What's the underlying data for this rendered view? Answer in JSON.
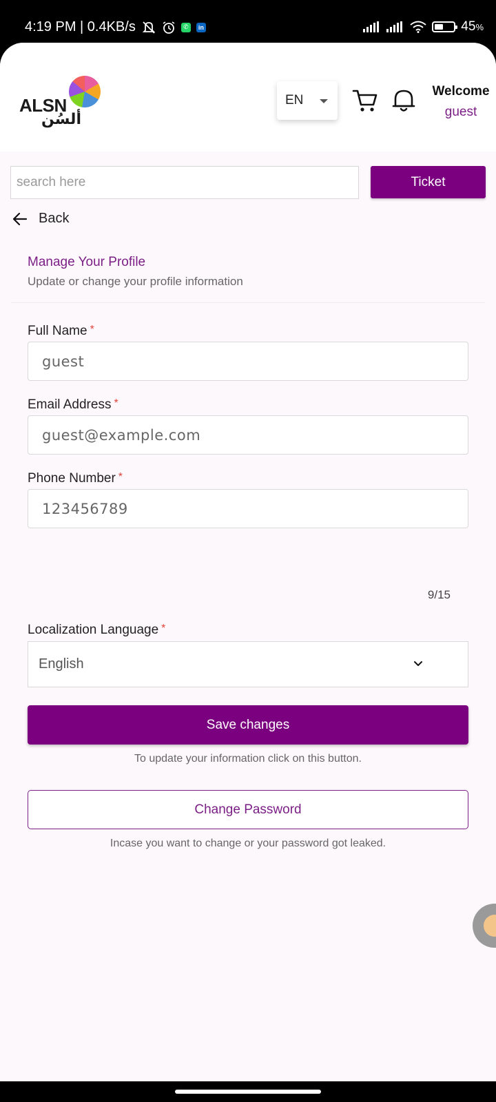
{
  "status_bar": {
    "time_info": "4:19 PM | 0.4KB/s",
    "battery": "45",
    "battery_suffix": "%",
    "battery_level": 0.45
  },
  "header": {
    "logo_text": "ALSN",
    "logo_arabic": "ألسُن",
    "language": "EN",
    "welcome_title": "Welcome",
    "welcome_user": "guest"
  },
  "search": {
    "placeholder": "search here",
    "ticket_label": "Ticket"
  },
  "nav": {
    "back_label": "Back"
  },
  "profile": {
    "title": "Manage Your Profile",
    "subtitle": "Update or change your profile information",
    "fields": {
      "full_name": {
        "label": "Full Name",
        "value": "guest"
      },
      "email": {
        "label": "Email Address",
        "value": "guest@example.com"
      },
      "phone": {
        "label": "Phone Number",
        "value": "123456789",
        "counter": "9/15"
      },
      "language": {
        "label": "Localization Language",
        "value": "English"
      }
    },
    "required_mark": "*",
    "save_label": "Save changes",
    "save_hint": "To update your information click on this button.",
    "change_password_label": "Change Password",
    "password_hint": "Incase you want to change or your password got leaked."
  },
  "colors": {
    "accent": "#7b0080",
    "accent_text": "#7b1f86",
    "required": "#e0443c"
  }
}
